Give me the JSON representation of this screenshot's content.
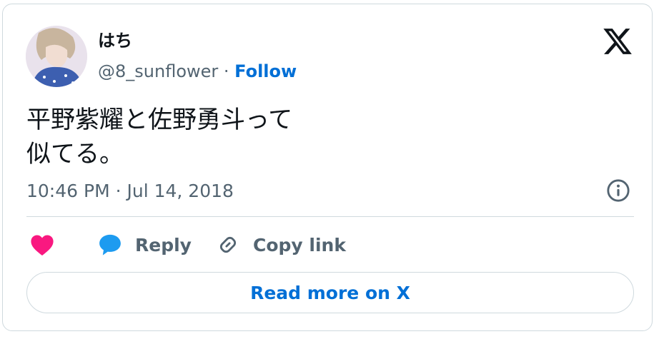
{
  "author": {
    "display_name": "はち",
    "handle": "@8_sunflower",
    "separator": " · ",
    "follow_label": "Follow"
  },
  "tweet": {
    "text_lines": [
      "平野紫耀と佐野勇斗って",
      "似てる。"
    ],
    "timestamp": "10:46 PM · Jul 14, 2018"
  },
  "actions": {
    "like_icon": "heart-icon",
    "reply_label": "Reply",
    "reply_icon": "speech-bubble-icon",
    "copy_label": "Copy link",
    "copy_icon": "link-icon"
  },
  "read_more_label": "Read more on X",
  "colors": {
    "accent": "#006fd6",
    "like": "#f91880",
    "reply": "#1d9bf0",
    "muted": "#536471",
    "text": "#0f1419",
    "border": "#cfd9de"
  }
}
